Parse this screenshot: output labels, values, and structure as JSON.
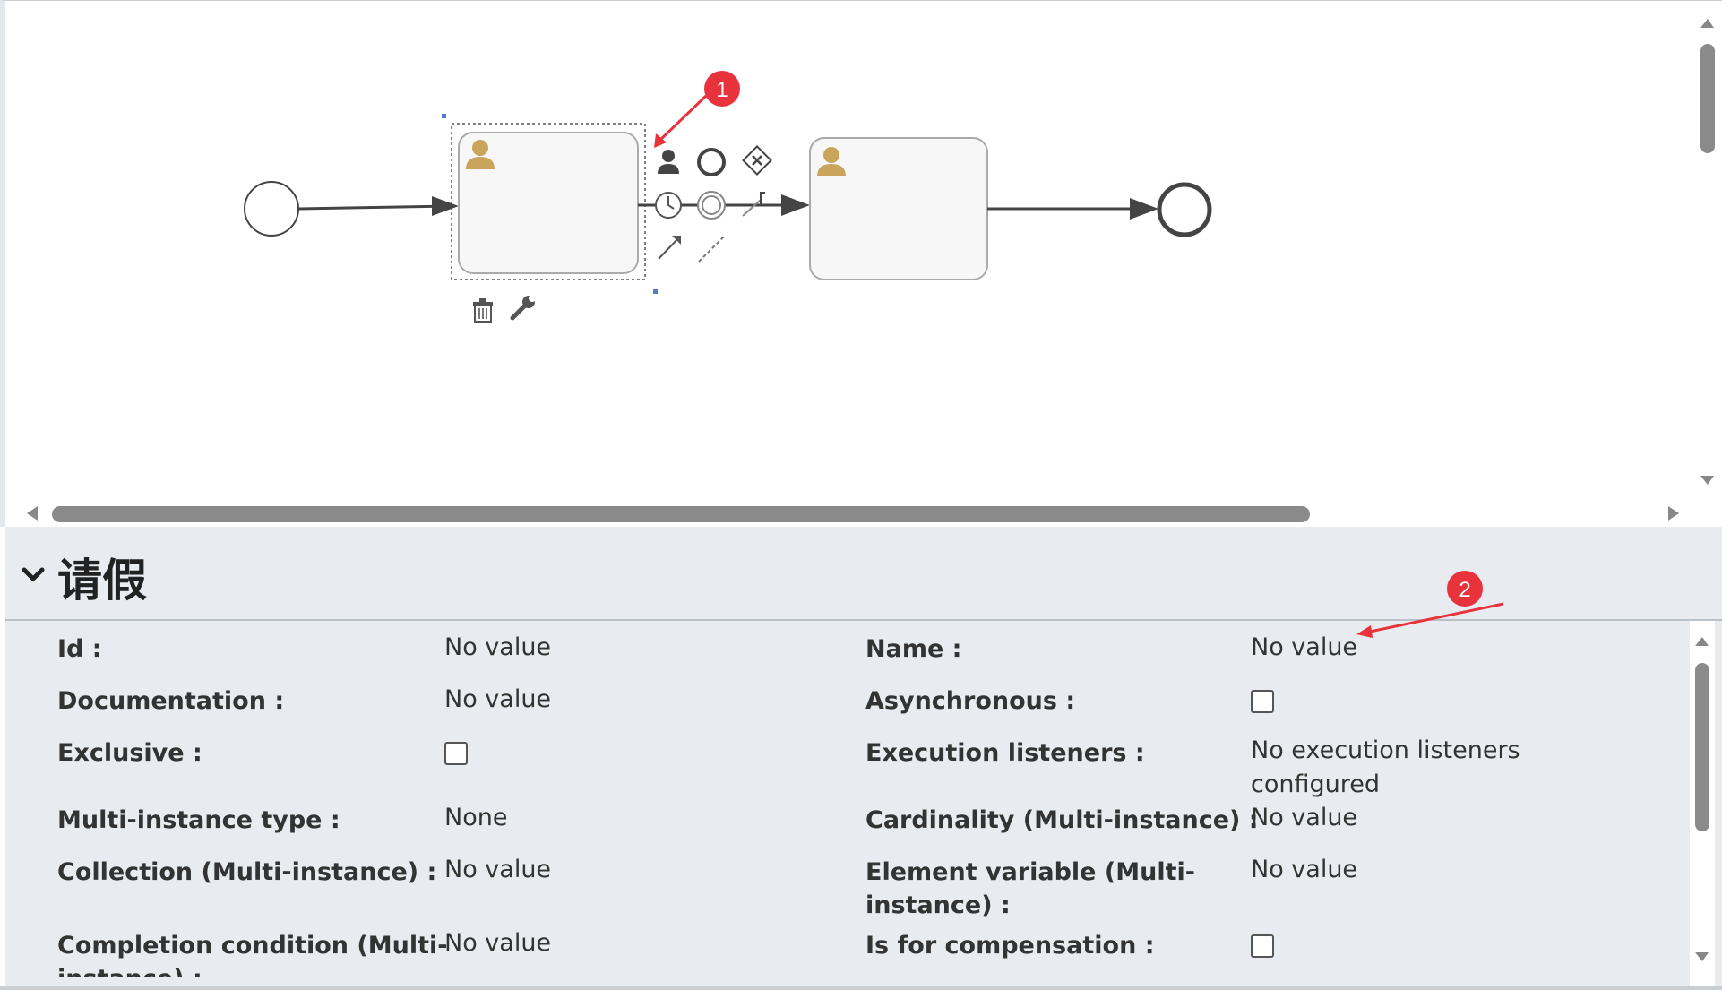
{
  "diagram": {
    "annotations": [
      {
        "label": "1"
      },
      {
        "label": "2"
      }
    ],
    "colors": {
      "annotation": "#e8323c",
      "task_icon": "#c9a45a",
      "scrollbar_thumb": "#8a8a8a"
    }
  },
  "panel": {
    "title": "请假",
    "properties": [
      {
        "label": "Id :",
        "value": "No value"
      },
      {
        "label": "Name :",
        "value": "No value"
      },
      {
        "label": "Documentation :",
        "value": "No value"
      },
      {
        "label": "Asynchronous :",
        "type": "checkbox",
        "checked": false
      },
      {
        "label": "Exclusive :",
        "type": "checkbox",
        "checked": false
      },
      {
        "label": "Execution listeners :",
        "value": "No execution listeners",
        "value2": "configured"
      },
      {
        "label": "Multi-instance type :",
        "value": "None"
      },
      {
        "label": "Cardinality (Multi-instance) :",
        "value": "No value"
      },
      {
        "label": "Collection (Multi-instance) :",
        "value": "No value"
      },
      {
        "label": "Element variable (Multi-",
        "label2": "instance) :",
        "value": "No value"
      },
      {
        "label": "Completion condition (Multi-",
        "label2": "instance) :",
        "value": "No value"
      },
      {
        "label": "Is for compensation :",
        "type": "checkbox",
        "checked": false
      }
    ]
  }
}
